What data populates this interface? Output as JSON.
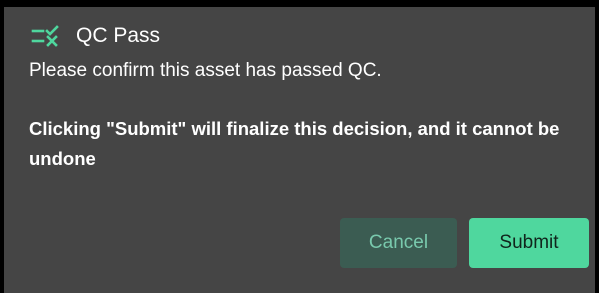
{
  "dialog": {
    "icon": "checklist-icon",
    "title": "QC Pass",
    "subtitle": "Please confirm this asset has passed QC.",
    "warning": "Clicking \"Submit\" will finalize this decision, and it cannot be undone",
    "cancel_label": "Cancel",
    "submit_label": "Submit"
  },
  "colors": {
    "background": "#454545",
    "accent": "#4fd79e",
    "cancel_bg": "#3b5c52",
    "cancel_text": "#79c9ad"
  }
}
